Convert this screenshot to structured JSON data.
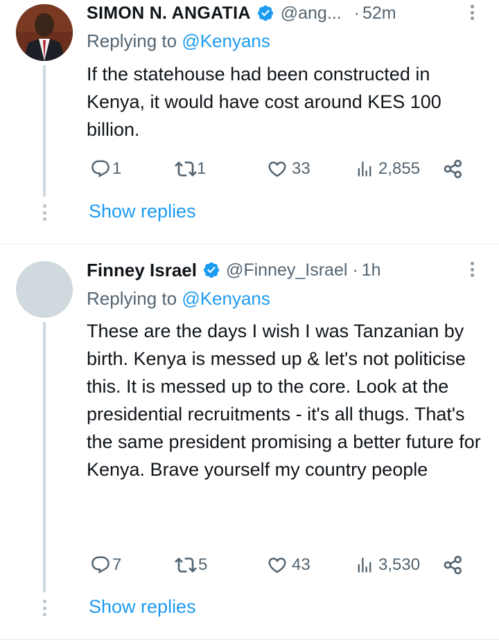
{
  "tweets": [
    {
      "name": "SIMON N. ANGATIA",
      "handle": "@ang...",
      "separator": "·",
      "time": "52m",
      "replying_prefix": "Replying to",
      "replying_to": "@Kenyans",
      "text": "If the statehouse had been constructed in Kenya, it would have cost around KES 100 billion.",
      "replies": "1",
      "retweets": "1",
      "likes": "33",
      "views": "2,855",
      "show_replies": "Show replies"
    },
    {
      "name": "Finney Israel",
      "handle": "@Finney_Israel",
      "separator": "·",
      "time": "1h",
      "replying_prefix": "Replying to",
      "replying_to": "@Kenyans",
      "text": "These are the days I wish I was Tanzanian by birth. Kenya is messed up & let's not politicise this. It is messed up to the core. Look at the presidential recruitments - it's all thugs. That's the same president promising a better future for Kenya. Brave yourself my country people",
      "replies": "7",
      "retweets": "5",
      "likes": "43",
      "views": "3,530",
      "show_replies": "Show replies"
    }
  ],
  "colors": {
    "link": "#1d9bf0",
    "secondary_text": "#536471",
    "verified_badge": "#1d9bf0",
    "thread_line": "#cfd9de"
  }
}
